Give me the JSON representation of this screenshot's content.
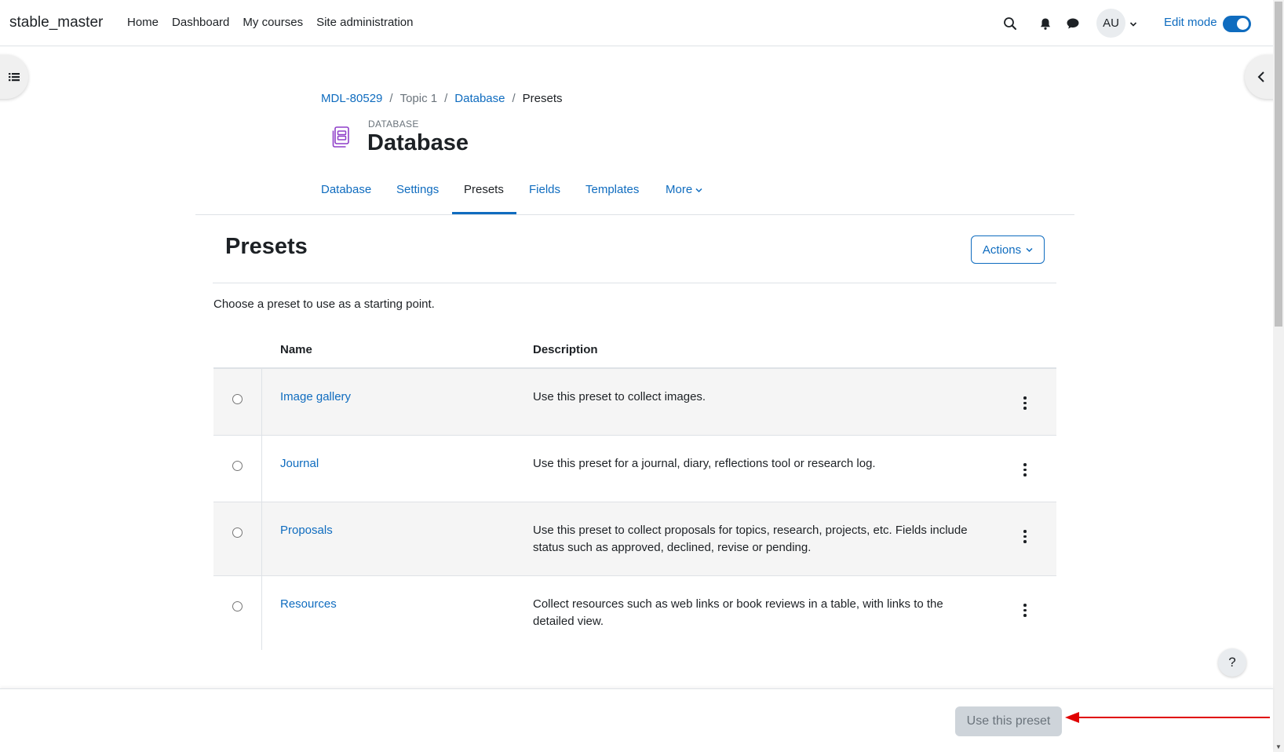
{
  "navbar": {
    "brand": "stable_master",
    "links": [
      "Home",
      "Dashboard",
      "My courses",
      "Site administration"
    ],
    "user_initials": "AU",
    "edit_mode_label": "Edit mode",
    "edit_mode_on": true
  },
  "breadcrumb": {
    "items": [
      "MDL-80529",
      "Topic 1",
      "Database",
      "Presets"
    ]
  },
  "module": {
    "kind": "DATABASE",
    "title": "Database"
  },
  "secondary_nav": {
    "items": [
      "Database",
      "Settings",
      "Presets",
      "Fields",
      "Templates",
      "More"
    ],
    "active": "Presets"
  },
  "page": {
    "heading": "Presets",
    "actions_label": "Actions",
    "intro": "Choose a preset to use as a starting point."
  },
  "table": {
    "headers": {
      "name": "Name",
      "description": "Description"
    },
    "rows": [
      {
        "name": "Image gallery",
        "description": "Use this preset to collect images."
      },
      {
        "name": "Journal",
        "description": "Use this preset for a journal, diary, reflections tool or research log."
      },
      {
        "name": "Proposals",
        "description": "Use this preset to collect proposals for topics, research, projects, etc. Fields include status such as approved, declined, revise or pending."
      },
      {
        "name": "Resources",
        "description": "Collect resources such as web links or book reviews in a table, with links to the detailed view."
      }
    ]
  },
  "help": {
    "label": "?"
  },
  "footer": {
    "use_preset_label": "Use this preset"
  },
  "colors": {
    "link": "#0f6cbf",
    "text": "#1d2125",
    "muted": "#6a737b",
    "annotation_arrow": "#e00000",
    "disabled_button": "#ced4da"
  }
}
